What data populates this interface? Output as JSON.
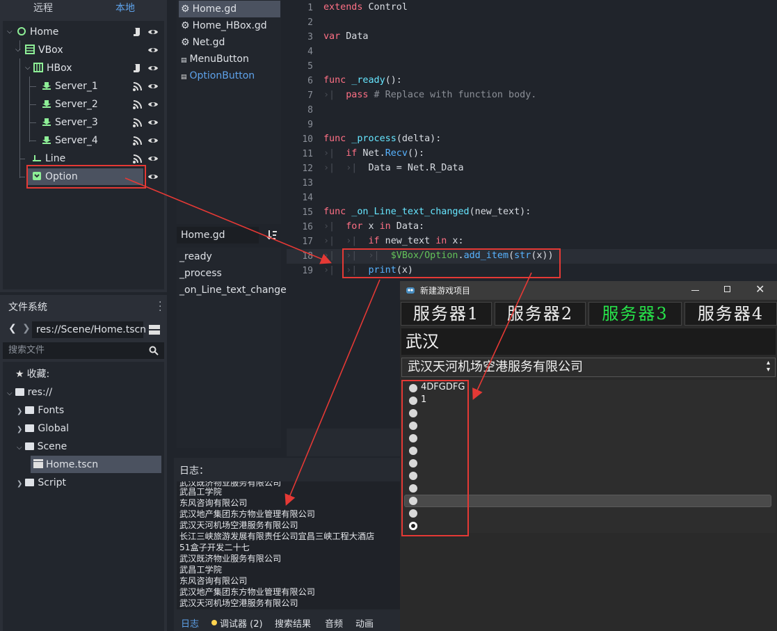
{
  "scene_tabs": {
    "remote": "远程",
    "local": "本地"
  },
  "scene_nodes": [
    {
      "label": "Home"
    },
    {
      "label": "VBox"
    },
    {
      "label": "HBox"
    },
    {
      "label": "Server_1"
    },
    {
      "label": "Server_2"
    },
    {
      "label": "Server_3"
    },
    {
      "label": "Server_4"
    },
    {
      "label": "Line"
    },
    {
      "label": "Option"
    }
  ],
  "filesystem": {
    "tab": "文件系统",
    "path": "res://Scene/Home.tscn",
    "search_placeholder": "搜索文件",
    "favorites": "收藏:",
    "root": "res://",
    "folders": [
      "Fonts",
      "Global",
      "Scene",
      "Script"
    ],
    "file": "Home.tscn"
  },
  "scripts": [
    "Home.gd",
    "Home_HBox.gd",
    "Net.gd",
    "MenuButton",
    "OptionButton"
  ],
  "methods_title": "Home.gd",
  "methods": [
    "_ready",
    "_process",
    "_on_Line_text_changed"
  ],
  "line_numbers": [
    "1",
    "2",
    "3",
    "4",
    "5",
    "6",
    "7",
    "8",
    "9",
    "10",
    "11",
    "12",
    "13",
    "14",
    "15",
    "16",
    "17",
    "18",
    "19"
  ],
  "code": {
    "extends_kw": "extends",
    "extends_class": " Control",
    "var_kw": "var",
    "var_name": " Data",
    "func_kw": "func",
    "ready_fn": " _ready",
    "ready_rest": "():",
    "pass_kw": "pass",
    "pass_comment": " # Replace with function body.",
    "process_fn": " _process",
    "process_rest": "(delta):",
    "if_kw": "if",
    "if_rest1": " Net.",
    "recv_fn": "Recv",
    "if_rest2": "():",
    "assign": "Data = Net.R_Data",
    "changed_fn": " _on_Line_text_changed",
    "changed_rest": "(new_text):",
    "for_kw": "for",
    "for_rest1": " x ",
    "in_kw": "in",
    "for_rest2": " Data:",
    "if2_rest1": " new_text ",
    "if2_rest2": " x:",
    "node_path": "$VBox/Option",
    "dot": ".",
    "add_item_fn": "add_item",
    "paren_open": "(",
    "str_fn": "str",
    "str_args": "(x))",
    "print_fn": "print",
    "print_args": "(x)"
  },
  "log": {
    "title": "日志：",
    "lines": [
      "武汉既济物业服务有限公司",
      "武昌工学院",
      "东风咨询有限公司",
      "武汉地产集团东方物业管理有限公司",
      "武汉天河机场空港服务有限公司",
      "长江三峡旅游发展有限责任公司宜昌三峡工程大酒店",
      "51盒子开发二十七",
      "武汉既济物业服务有限公司",
      "武昌工学院",
      "东风咨询有限公司",
      "武汉地产集团东方物业管理有限公司",
      "武汉天河机场空港服务有限公司"
    ],
    "tabs": [
      "日志",
      "调试器 (2)",
      "搜索结果",
      "音频",
      "动画"
    ]
  },
  "game": {
    "title": "新建游戏项目",
    "servers": [
      "服务器1",
      "服务器2",
      "服务器3",
      "服务器4"
    ],
    "input_value": "武汉",
    "selected_option": "武汉天河机场空港服务有限公司",
    "items": [
      "4DFGDFG",
      "1",
      "",
      "",
      "",
      "",
      "",
      "",
      "",
      "",
      "",
      ""
    ]
  },
  "colors": {
    "accent": "#5ea2ea",
    "selected_server": "#27e34a",
    "highlight": "#e53935"
  }
}
